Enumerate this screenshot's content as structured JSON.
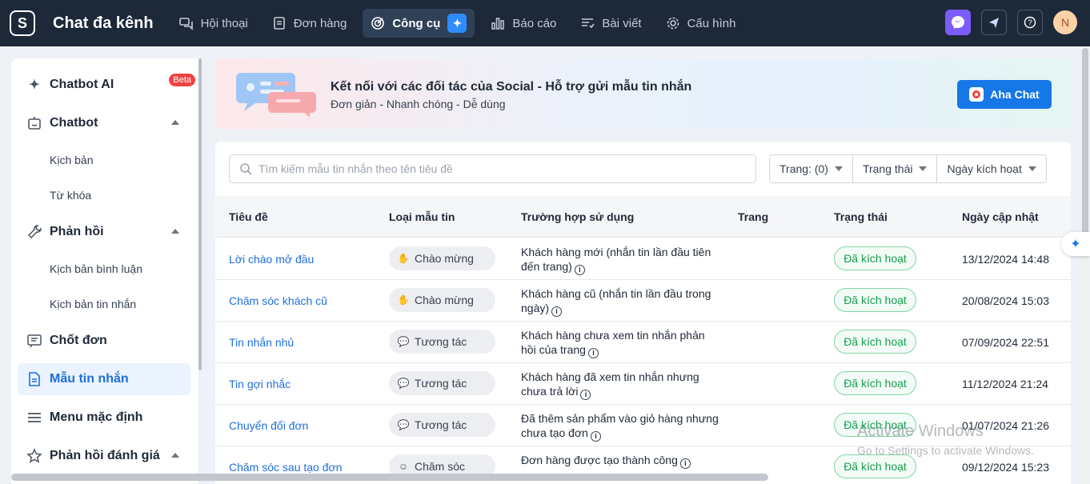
{
  "app": {
    "logo_letter": "S",
    "title": "Chat đa kênh"
  },
  "nav": [
    {
      "label": "Hội thoại",
      "icon": "chat-icon",
      "active": false
    },
    {
      "label": "Đơn hàng",
      "icon": "order-icon",
      "active": false
    },
    {
      "label": "Công cụ",
      "icon": "tools-icon",
      "active": true
    },
    {
      "label": "Báo cáo",
      "icon": "report-icon",
      "active": false
    },
    {
      "label": "Bài viết",
      "icon": "post-icon",
      "active": false
    },
    {
      "label": "Cấu hình",
      "icon": "gear-icon",
      "active": false
    }
  ],
  "user": {
    "avatar_initial": "N"
  },
  "sidebar": {
    "items": [
      {
        "label": "Chatbot AI",
        "badge": "Beta"
      },
      {
        "label": "Chatbot"
      },
      {
        "label": "Kịch bản"
      },
      {
        "label": "Từ khóa"
      },
      {
        "label": "Phản hồi"
      },
      {
        "label": "Kịch bản bình luận"
      },
      {
        "label": "Kịch bản tin nhắn"
      },
      {
        "label": "Chốt đơn"
      },
      {
        "label": "Mẫu tin nhắn",
        "active": true
      },
      {
        "label": "Menu mặc định"
      },
      {
        "label": "Phản hồi đánh giá"
      }
    ]
  },
  "banner": {
    "title": "Kết nối với các đối tác của Social - Hỗ trợ gửi mẫu tin nhắn",
    "subtitle": "Đơn giản - Nhanh chóng - Dễ dùng",
    "button_label": "Aha Chat"
  },
  "search": {
    "placeholder": "Tìm kiếm mẫu tin nhắn theo tên tiêu đề",
    "value": ""
  },
  "filters": [
    "Trang: (0)",
    "Trạng thái",
    "Ngày kích hoạt"
  ],
  "table": {
    "columns": [
      "Tiêu đề",
      "Loại mẫu tin",
      "Trường hợp sử dụng",
      "Trang",
      "Trạng thái",
      "Ngày cập nhật"
    ],
    "rows": [
      {
        "title": "Lời chào mở đầu",
        "type": "Chào mừng",
        "type_icon": "wave-icon",
        "usecase": "Khách hàng mới (nhắn tin lần đầu tiên đến trang)",
        "page": "",
        "status": "Đã kích hoạt",
        "updated": "13/12/2024 14:48"
      },
      {
        "title": "Chăm sóc khách cũ",
        "type": "Chào mừng",
        "type_icon": "wave-icon",
        "usecase": "Khách hàng cũ (nhắn tin lần đầu trong ngày)",
        "page": "",
        "status": "Đã kích hoạt",
        "updated": "20/08/2024 15:03"
      },
      {
        "title": "Tin nhắn nhủ",
        "type": "Tương tác",
        "type_icon": "chat-bubble-icon",
        "usecase": "Khách hàng chưa xem tin nhắn phản hồi của trang",
        "page": "",
        "status": "Đã kích hoạt",
        "updated": "07/09/2024 22:51"
      },
      {
        "title": "Tin gợi nhắc",
        "type": "Tương tác",
        "type_icon": "chat-bubble-icon",
        "usecase": "Khách hàng đã xem tin nhắn nhưng chưa trả lời",
        "page": "",
        "status": "Đã kích hoạt",
        "updated": "11/12/2024 21:24"
      },
      {
        "title": "Chuyển đổi đơn",
        "type": "Tương tác",
        "type_icon": "chat-bubble-icon",
        "usecase": "Đã thêm sản phẩm vào giỏ hàng nhưng chưa tạo đơn",
        "page": "",
        "status": "Đã kích hoạt",
        "updated": "01/07/2024 21:26"
      },
      {
        "title": "Chăm sóc sau tạo đơn",
        "type": "Chăm sóc",
        "type_icon": "care-icon",
        "usecase": "Đơn hàng được tạo thành công",
        "page": "",
        "status": "Đã kích hoạt",
        "updated": "09/12/2024 15:23"
      }
    ]
  },
  "watermark": {
    "line1": "Activate Windows",
    "line2": "Go to Settings to activate Windows."
  },
  "colors": {
    "topbar": "#1d2939",
    "accent": "#1e6fd9",
    "status_green": "#15a150",
    "beta_red": "#ef4444"
  }
}
